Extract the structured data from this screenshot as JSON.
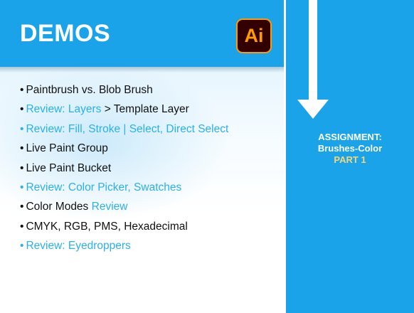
{
  "header": {
    "title": "DEMOS",
    "logo_text": "Ai",
    "logo_icon": "adobe-illustrator-icon"
  },
  "bullets": [
    {
      "marker": "•",
      "parts": [
        {
          "text": "Paintbrush vs. Blob Brush",
          "style": "normal"
        }
      ]
    },
    {
      "marker": "•",
      "parts": [
        {
          "text": "Review: Layers",
          "style": "accent"
        },
        {
          "text": " > Template Layer",
          "style": "normal"
        }
      ]
    },
    {
      "marker": "•",
      "parts": [
        {
          "text": "Review: Fill, Stroke | Select, Direct Select",
          "style": "accent"
        }
      ]
    },
    {
      "marker": "•",
      "parts": [
        {
          "text": "Live Paint Group",
          "style": "normal"
        }
      ]
    },
    {
      "marker": "•",
      "parts": [
        {
          "text": "Live Paint Bucket",
          "style": "normal"
        }
      ]
    },
    {
      "marker": "•",
      "parts": [
        {
          "text": "Review: Color Picker, Swatches",
          "style": "accent"
        }
      ]
    },
    {
      "marker": "•",
      "parts": [
        {
          "text": "Color Modes ",
          "style": "normal"
        },
        {
          "text": "Review",
          "style": "accent"
        }
      ]
    },
    {
      "marker": "•",
      "parts": [
        {
          "text": "CMYK, RGB, PMS, Hexadecimal",
          "style": "normal"
        }
      ]
    },
    {
      "marker": "•",
      "parts": [
        {
          "text": "Review: Eyedroppers",
          "style": "accent"
        }
      ]
    }
  ],
  "sidebar": {
    "arrow_icon": "down-arrow-icon",
    "assignment_label": "ASSIGNMENT:",
    "assignment_name": "Brushes-Color",
    "assignment_part": "PART 1"
  },
  "colors": {
    "brand_blue": "#1aa3e8",
    "accent_text": "#2ab0ee",
    "part_highlight": "#f5d67a",
    "ai_logo_bg": "#330000",
    "ai_logo_fg": "#ff9a00"
  }
}
